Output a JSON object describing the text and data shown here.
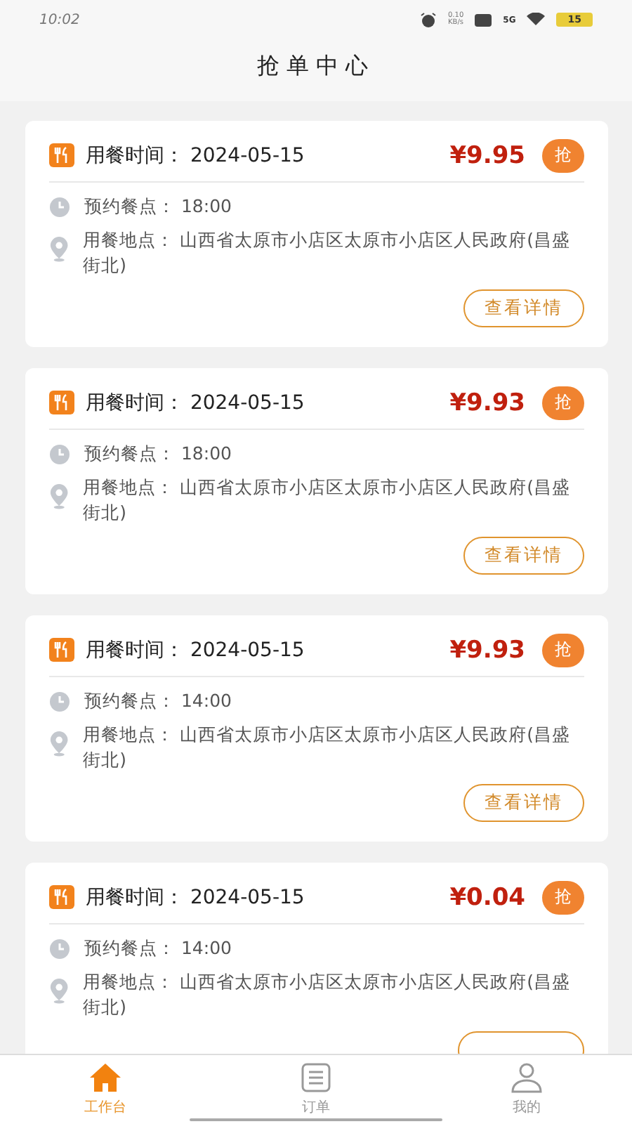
{
  "status_bar": {
    "time": "10:02",
    "speed": "0.10",
    "speed_unit": "KB/s",
    "network": "5G",
    "battery": "15"
  },
  "title": "抢单中心",
  "orders": [
    {
      "meal_time_label": "用餐时间：",
      "meal_date": "2024-05-15",
      "price": "¥9.95",
      "grab": "抢",
      "slot_label": "预约餐点：",
      "slot": "18:00",
      "place_label": "用餐地点：",
      "place": "山西省太原市小店区太原市小店区人民政府(昌盛街北)",
      "detail": "查看详情"
    },
    {
      "meal_time_label": "用餐时间：",
      "meal_date": "2024-05-15",
      "price": "¥9.93",
      "grab": "抢",
      "slot_label": "预约餐点：",
      "slot": "18:00",
      "place_label": "用餐地点：",
      "place": "山西省太原市小店区太原市小店区人民政府(昌盛街北)",
      "detail": "查看详情"
    },
    {
      "meal_time_label": "用餐时间：",
      "meal_date": "2024-05-15",
      "price": "¥9.93",
      "grab": "抢",
      "slot_label": "预约餐点：",
      "slot": "14:00",
      "place_label": "用餐地点：",
      "place": "山西省太原市小店区太原市小店区人民政府(昌盛街北)",
      "detail": "查看详情"
    },
    {
      "meal_time_label": "用餐时间：",
      "meal_date": "2024-05-15",
      "price": "¥0.04",
      "grab": "抢",
      "slot_label": "预约餐点：",
      "slot": "14:00",
      "place_label": "用餐地点：",
      "place": "山西省太原市小店区太原市小店区人民政府(昌盛街北)"
    }
  ],
  "tabs": [
    {
      "label": "工作台",
      "kind": "home",
      "selected": true
    },
    {
      "label": "订单",
      "kind": "list",
      "selected": false
    },
    {
      "label": "我的",
      "kind": "user",
      "selected": false
    }
  ]
}
